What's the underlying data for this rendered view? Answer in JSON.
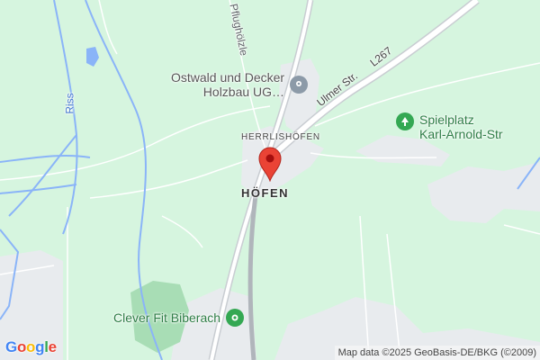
{
  "map": {
    "background": "#d6f5df",
    "road_color": "#ffffff",
    "urban_color": "#e8ebee",
    "park_color": "#a8ddb5",
    "water_color": "#8ab4f8",
    "marker_color": "#ea4335"
  },
  "labels": {
    "street_pflughoelzle": "Pflughölzle",
    "river_riss": "Riss",
    "road_ulmer": "Ulmer Str.",
    "road_l267": "L267",
    "locality_herrlishoefen": "HERRLISHÖFEN",
    "locality_hoefen": "HÖFEN"
  },
  "pois": {
    "ostwald": {
      "line1": "Ostwald und Decker",
      "line2": "Holzbau UG…",
      "icon": "location-pin-icon"
    },
    "spielplatz": {
      "line1": "Spielplatz",
      "line2": "Karl-Arnold-Str",
      "icon": "tree-icon"
    },
    "cleverfit": {
      "line1": "Clever Fit Biberach",
      "icon": "fitness-icon"
    }
  },
  "marker": {
    "icon": "map-marker-icon"
  },
  "footer": {
    "logo": "Google",
    "attribution": "Map data ©2025 GeoBasis-DE/BKG (©2009)"
  }
}
